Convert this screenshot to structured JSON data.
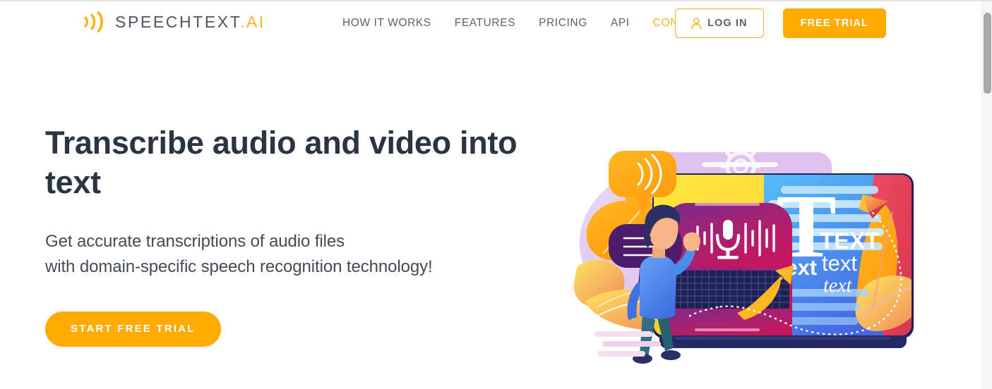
{
  "brand": {
    "logo_icon": "sound-wave-icon",
    "name_primary": "SPEECHTEXT",
    "name_accent": ".AI",
    "accent_color": "#fbb323",
    "text_color": "#4d5560"
  },
  "nav": {
    "items": [
      {
        "label": "HOW IT WORKS",
        "active": false
      },
      {
        "label": "FEATURES",
        "active": false
      },
      {
        "label": "PRICING",
        "active": false
      },
      {
        "label": "API",
        "active": false
      },
      {
        "label": "CONTACT US",
        "active": true
      }
    ]
  },
  "header_actions": {
    "login_label": "LOG IN",
    "login_icon": "user-icon",
    "free_trial_label": "FREE TRIAL",
    "button_color": "#ffab00"
  },
  "hero": {
    "title": "Transcribe audio and video into text",
    "subtitle_line_1": "Get accurate transcriptions of audio files",
    "subtitle_line_2": "with domain-specific speech recognition technology!",
    "cta_label": "START FREE TRIAL",
    "cta_color": "#ffab00",
    "title_color": "#2b3442"
  },
  "illustration": {
    "name": "speech-to-text-illustration",
    "text_labels": {
      "big_t": "T",
      "caps": "TEXT",
      "bold": "text",
      "regular": "text",
      "italic": "text"
    },
    "elements": [
      "lavender-blob",
      "orange-leaves",
      "speech-bubble-sound",
      "speech-bubble-lines",
      "gears",
      "laptop-frame",
      "yellow-screen",
      "microphone-card",
      "waveform-bars",
      "grid-keyboard",
      "blue-text-panel",
      "paper-plane",
      "dotted-path",
      "orange-arrow",
      "person-figure",
      "pink-lines"
    ],
    "colors": {
      "lavender": "#d6bdec",
      "orange": "#ffa91f",
      "yellow": "#ffd93b",
      "magenta": "#b51f6b",
      "purple": "#6b2a8e",
      "navy": "#1d2155",
      "blue_panel_top": "#52b9f5",
      "blue_panel_bottom": "#4a74e8",
      "coral": "#e8485f",
      "shirt_blue": "#4a8df0",
      "pants_teal": "#2f6f7e"
    }
  },
  "scrollbar": {
    "present": true,
    "thumb_color": "#a8a8a8"
  }
}
